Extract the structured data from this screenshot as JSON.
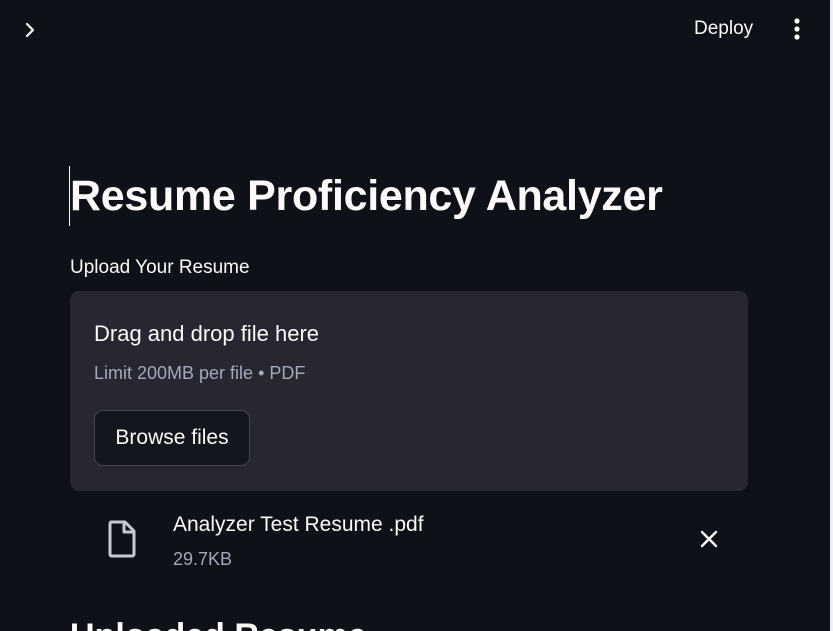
{
  "header": {
    "sidebar_toggle_icon": "chevron-right-icon",
    "deploy_label": "Deploy",
    "menu_icon": "vertical-dots-icon"
  },
  "main": {
    "title": "Resume Proficiency Analyzer",
    "uploader": {
      "label": "Upload Your Resume",
      "dropzone_title": "Drag and drop file here",
      "limit_text": "Limit 200MB per file • PDF",
      "browse_label": "Browse files"
    },
    "uploaded_file": {
      "icon": "file-icon",
      "name": "Analyzer Test Resume .pdf",
      "size": "29.7KB",
      "remove_icon": "close-icon"
    },
    "next_section_heading_partial": "Uploaded Resume"
  },
  "colors": {
    "background": "#0e1117",
    "dropzone_background": "#262730",
    "text": "#fafafa",
    "muted_text": "#a3a8b8",
    "button_background": "#14161d",
    "button_border": "#43464f"
  }
}
